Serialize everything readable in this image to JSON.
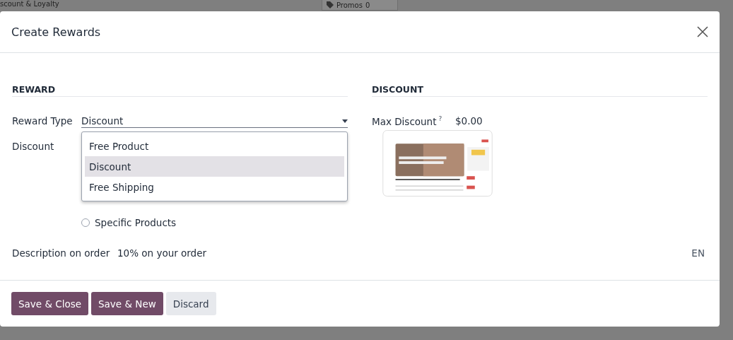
{
  "background": {
    "breadcrumb": "scount & Loyalty",
    "stat_button": {
      "label": "Promos",
      "count": "0"
    }
  },
  "dialog": {
    "title": "Create Rewards"
  },
  "reward": {
    "heading": "REWARD",
    "reward_type": {
      "label": "Reward Type",
      "value": "Discount",
      "options": [
        {
          "label": "Free Product",
          "selected": false
        },
        {
          "label": "Discount",
          "selected": true
        },
        {
          "label": "Free Shipping",
          "selected": false
        }
      ]
    },
    "discount": {
      "label": "Discount",
      "apply_on": [
        {
          "label": "Specific Products",
          "selected": false
        }
      ]
    }
  },
  "discount_section": {
    "heading": "DISCOUNT",
    "max_discount": {
      "label": "Max Discount",
      "help": "?",
      "value": "$0.00"
    }
  },
  "description": {
    "label": "Description on order",
    "value": "10% on your order",
    "language": "EN"
  },
  "buttons": [
    {
      "label": "Save & Close",
      "kind": "primary"
    },
    {
      "label": "Save & New",
      "kind": "primary"
    },
    {
      "label": "Discard",
      "kind": "secondary"
    }
  ]
}
